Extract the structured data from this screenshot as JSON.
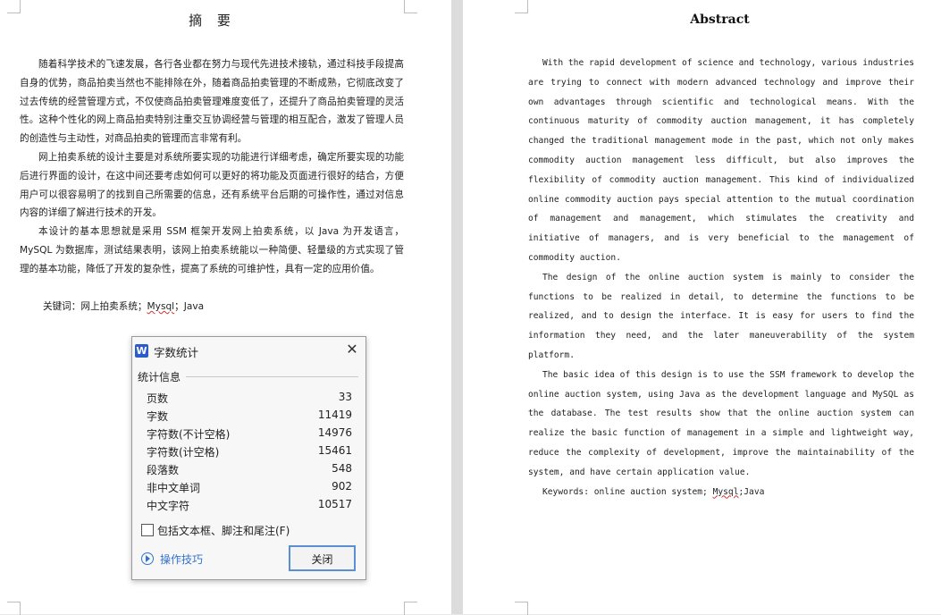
{
  "left_page": {
    "title": "摘 要",
    "paragraphs": [
      "随着科学技术的飞速发展，各行各业都在努力与现代先进技术接轨，通过科技手段提高自身的优势，商品拍卖当然也不能排除在外，随着商品拍卖管理的不断成熟，它彻底改变了过去传统的经营管理方式，不仅使商品拍卖管理难度变低了，还提升了商品拍卖管理的灵活性。这种个性化的网上商品拍卖特别注重交互协调经营与管理的相互配合，激发了管理人员的创造性与主动性，对商品拍卖的管理而言非常有利。",
      "网上拍卖系统的设计主要是对系统所要实现的功能进行详细考虑，确定所要实现的功能后进行界面的设计，在这中间还要考虑如何可以更好的将功能及页面进行很好的结合，方便用户可以很容易明了的找到自己所需要的信息，还有系统平台后期的可操作性，通过对信息内容的详细了解进行技术的开发。",
      "本设计的基本思想就是采用 SSM 框架开发网上拍卖系统，以 Java 为开发语言，MySQL 为数据库，测试结果表明，该网上拍卖系统能以一种简便、轻量级的方式实现了管理的基本功能，降低了开发的复杂性，提高了系统的可维护性，具有一定的应用价值。"
    ],
    "keywords_prefix": "关键词：网上拍卖系统；",
    "keywords_mysql": "Mysql",
    "keywords_java": "；Java"
  },
  "right_page": {
    "title": "Abstract",
    "paragraphs": [
      "With the rapid development of science and technology, various industries are trying to connect with modern advanced technology and improve their own advantages through scientific and technological means. With the continuous maturity of commodity auction management, it has completely changed the traditional management mode in the past, which not only makes commodity auction management less difficult, but also improves the flexibility of commodity auction management. This kind of individualized online commodity auction pays special attention to the mutual coordination of management and management, which stimulates the creativity and initiative of managers, and is very beneficial to the management of commodity auction.",
      "The design of the online auction system is mainly to consider the functions to be realized in detail, to determine the functions to be realized, and to design the interface. It is easy for users to find the information they need, and the later maneuverability of the system platform.",
      "The basic idea of this design is to use the SSM framework to develop the online auction system, using Java as the development language and MySQL as the database. The test results show that the online auction system can realize the basic function of management in a simple and lightweight way, reduce the complexity of development, improve the maintainability of the system, and have certain application value."
    ],
    "keywords_prefix": "Keywords: online auction system; ",
    "keywords_mysql": "Mysql",
    "keywords_java": ";Java"
  },
  "dialog": {
    "logo": "W",
    "title": "字数统计",
    "close_glyph": "✕",
    "group_label": "统计信息",
    "stats": [
      {
        "label": "页数",
        "value": "33"
      },
      {
        "label": "字数",
        "value": "11419"
      },
      {
        "label": "字符数(不计空格)",
        "value": "14976"
      },
      {
        "label": "字符数(计空格)",
        "value": "15461"
      },
      {
        "label": "段落数",
        "value": "548"
      },
      {
        "label": "非中文单词",
        "value": "902"
      },
      {
        "label": "中文字符",
        "value": "10517"
      }
    ],
    "checkbox_label": "包括文本框、脚注和尾注(F)",
    "checkbox_checked": false,
    "tips_label": "操作技巧",
    "close_button": "关闭"
  }
}
